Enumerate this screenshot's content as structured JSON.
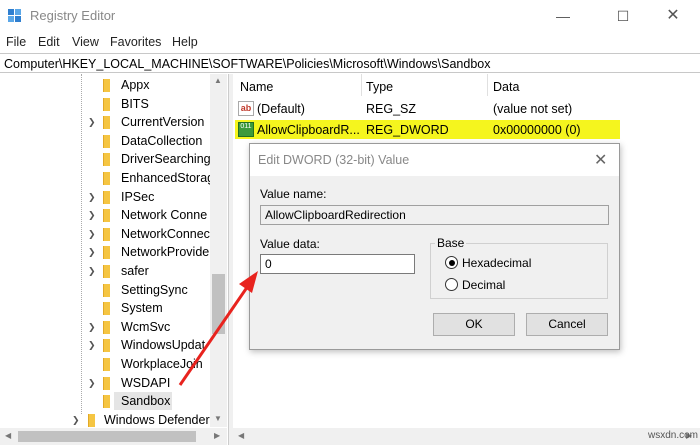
{
  "window": {
    "title": "Registry Editor",
    "minimize_glyph": "—",
    "maximize_glyph": "☐",
    "close_glyph": "✕"
  },
  "menu": [
    "File",
    "Edit",
    "View",
    "Favorites",
    "Help"
  ],
  "address": "Computer\\HKEY_LOCAL_MACHINE\\SOFTWARE\\Policies\\Microsoft\\Windows\\Sandbox",
  "tree": {
    "items": [
      {
        "label": "Appx",
        "expandable": false
      },
      {
        "label": "BITS",
        "expandable": false
      },
      {
        "label": "CurrentVersion",
        "expandable": true
      },
      {
        "label": "DataCollection",
        "expandable": false
      },
      {
        "label": "DriverSearching",
        "expandable": false
      },
      {
        "label": "EnhancedStorag",
        "expandable": false
      },
      {
        "label": "IPSec",
        "expandable": true
      },
      {
        "label": "Network Conne",
        "expandable": true
      },
      {
        "label": "NetworkConnec",
        "expandable": true
      },
      {
        "label": "NetworkProvide",
        "expandable": true
      },
      {
        "label": "safer",
        "expandable": true
      },
      {
        "label": "SettingSync",
        "expandable": false
      },
      {
        "label": "System",
        "expandable": false
      },
      {
        "label": "WcmSvc",
        "expandable": true
      },
      {
        "label": "WindowsUpdat",
        "expandable": true
      },
      {
        "label": "WorkplaceJoin",
        "expandable": false
      },
      {
        "label": "WSDAPI",
        "expandable": true
      },
      {
        "label": "Sandbox",
        "expandable": false,
        "selected": true
      }
    ],
    "parent_item": {
      "label": "Windows Defender",
      "expandable": true
    }
  },
  "list": {
    "columns": {
      "name": "Name",
      "type": "Type",
      "data": "Data"
    },
    "rows": [
      {
        "name": "(Default)",
        "type": "REG_SZ",
        "data": "(value not set)",
        "icon": "string-value-icon",
        "icon_text": "ab"
      },
      {
        "name": "AllowClipboardR...",
        "type": "REG_DWORD",
        "data": "0x00000000 (0)",
        "icon": "binary-value-icon",
        "icon_text": "011",
        "highlighted": true
      }
    ]
  },
  "dialog": {
    "title": "Edit DWORD (32-bit) Value",
    "value_name_label": "Value name:",
    "value_name": "AllowClipboardRedirection",
    "value_data_label": "Value data:",
    "value_data": "0",
    "base_label": "Base",
    "base_options": [
      {
        "label": "Hexadecimal",
        "checked": true
      },
      {
        "label": "Decimal",
        "checked": false
      }
    ],
    "ok_label": "OK",
    "cancel_label": "Cancel"
  },
  "colors": {
    "highlight": "#f5f51e",
    "arrow": "#e8231e",
    "folder": "#f5c542"
  },
  "watermark": "wsxdn.com"
}
